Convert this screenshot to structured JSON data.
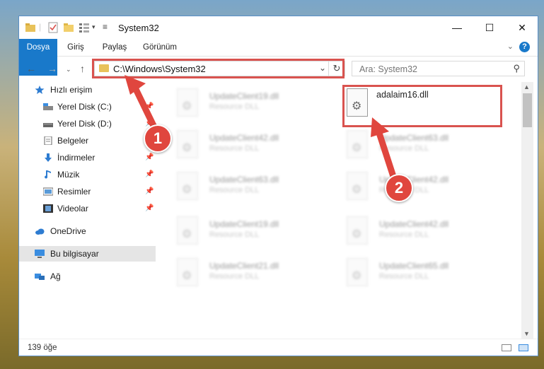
{
  "window": {
    "title": "System32",
    "minimize": "—",
    "maximize": "☐",
    "close": "✕"
  },
  "ribbon": {
    "tabs": [
      "Dosya",
      "Giriş",
      "Paylaş",
      "Görünüm"
    ],
    "help": "?"
  },
  "nav": {
    "path": "C:\\Windows\\System32",
    "search_placeholder": "Ara: System32"
  },
  "sidebar": {
    "items": [
      {
        "label": "Hızlı erişim",
        "icon": "star-icon"
      },
      {
        "label": "Yerel Disk (C:)",
        "icon": "drive-icon",
        "pinned": true
      },
      {
        "label": "Yerel Disk (D:)",
        "icon": "drive-icon",
        "pinned": true
      },
      {
        "label": "Belgeler",
        "icon": "documents-icon",
        "pinned": true
      },
      {
        "label": "İndirmeler",
        "icon": "download-icon",
        "pinned": true
      },
      {
        "label": "Müzik",
        "icon": "music-icon",
        "pinned": true
      },
      {
        "label": "Resimler",
        "icon": "pictures-icon",
        "pinned": true
      },
      {
        "label": "Videolar",
        "icon": "video-icon",
        "pinned": true
      },
      {
        "label": "OneDrive",
        "icon": "cloud-icon"
      },
      {
        "label": "Bu bilgisayar",
        "icon": "computer-icon",
        "selected": true
      },
      {
        "label": "Ağ",
        "icon": "network-icon"
      }
    ]
  },
  "files": {
    "left": [
      {
        "name": "UpdateClient19.dll",
        "type": "Resource DLL"
      },
      {
        "name": "UpdateClient42.dll",
        "type": "Resource DLL"
      },
      {
        "name": "UpdateClient63.dll",
        "type": "Resource DLL"
      },
      {
        "name": "UpdateClient19.dll",
        "type": "Resource DLL"
      },
      {
        "name": "UpdateClient21.dll",
        "type": "Resource DLL"
      }
    ],
    "right": [
      {
        "name": "adalaim16.dll",
        "type": ""
      },
      {
        "name": "UpdateClient63.dll",
        "type": "Resource DLL"
      },
      {
        "name": "UpdateClient42.dll",
        "type": "Resource DLL"
      },
      {
        "name": "UpdateClient42.dll",
        "type": "Resource DLL"
      },
      {
        "name": "UpdateClient65.dll",
        "type": "Resource DLL"
      }
    ]
  },
  "status": {
    "count": "139 öğe"
  },
  "callouts": [
    "1",
    "2"
  ],
  "colors": {
    "accent": "#1979ca",
    "highlight": "#d9534f",
    "callout": "#e0463e"
  }
}
